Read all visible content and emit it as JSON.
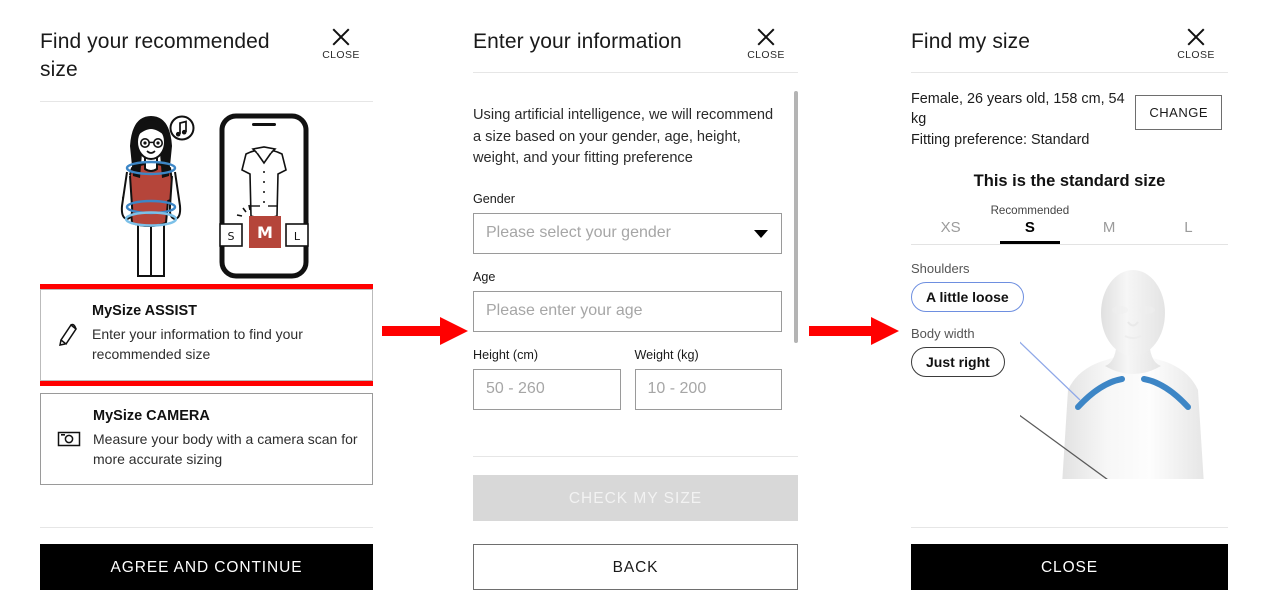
{
  "panels": {
    "panel1": {
      "title": "Find your recommended size",
      "close_label": "CLOSE",
      "close_icon": "close-icon",
      "illustration_alt": "woman-with-measurement-rings-and-phone-size-recommendation",
      "options": [
        {
          "id": "mysize-assist",
          "icon": "pencil-icon",
          "title": "MySize ASSIST",
          "desc": "Enter your information to find your recommended size",
          "highlighted": true
        },
        {
          "id": "mysize-camera",
          "icon": "camera-icon",
          "title": "MySize CAMERA",
          "desc": "Measure your body with a camera scan for more accurate sizing",
          "highlighted": false
        }
      ],
      "primary_button": "AGREE AND CONTINUE"
    },
    "panel2": {
      "title": "Enter your information",
      "close_label": "CLOSE",
      "close_icon": "close-icon",
      "intro": "Using artificial intelligence, we will recommend a size based on your gender, age, height, weight, and your fitting preference",
      "fields": {
        "gender": {
          "label": "Gender",
          "placeholder": "Please select your gender",
          "value": "",
          "caret_icon": "chevron-down-icon"
        },
        "age": {
          "label": "Age",
          "placeholder": "Please enter your age",
          "value": ""
        },
        "height": {
          "label": "Height (cm)",
          "placeholder": "50 - 260",
          "value": ""
        },
        "weight": {
          "label": "Weight (kg)",
          "placeholder": "10 - 200",
          "value": ""
        }
      },
      "submit_button": "CHECK MY SIZE",
      "submit_disabled": true,
      "back_button": "BACK"
    },
    "panel3": {
      "title": "Find my size",
      "close_label": "CLOSE",
      "close_icon": "close-icon",
      "summary_line1": "Female, 26 years old, 158 cm, 54 kg",
      "summary_line2": "Fitting preference: Standard",
      "change_button": "CHANGE",
      "standard_headline": "This is the standard size",
      "recommended_label": "Recommended",
      "size_tabs": [
        {
          "size": "XS",
          "recommended": false
        },
        {
          "size": "S",
          "recommended": true
        },
        {
          "size": "M",
          "recommended": false
        },
        {
          "size": "L",
          "recommended": false
        }
      ],
      "fit_callouts": [
        {
          "label": "Shoulders",
          "value": "A little loose",
          "accent": "#6e8fe0"
        },
        {
          "label": "Body width",
          "value": "Just right",
          "accent": "#3b3b3b"
        }
      ],
      "mannequin_alt": "mannequin-torso-with-shoulder-highlight",
      "close_button": "CLOSE"
    }
  },
  "arrows": [
    {
      "id": "arrow-panel1-to-panel2",
      "color": "#ff0000"
    },
    {
      "id": "arrow-panel2-to-panel3",
      "color": "#ff0000"
    }
  ],
  "colors": {
    "highlight_red": "#ff0000",
    "accent_blue": "#3d86c6",
    "pill_blue": "#6e8fe0",
    "shirt_red": "#b5453a",
    "black": "#000000"
  }
}
